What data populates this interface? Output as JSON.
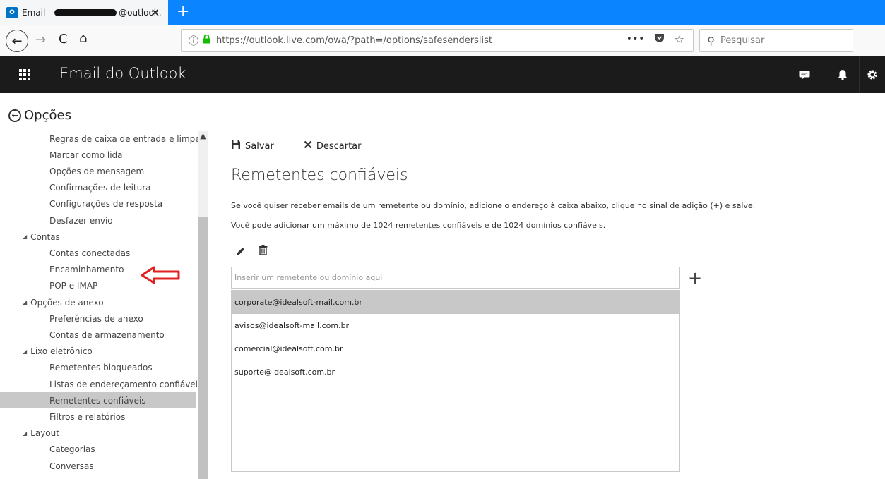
{
  "browser": {
    "tab": {
      "favicon": "O",
      "title_prefix": "Email –",
      "title_suffix": "@outlook.",
      "close": "✕"
    },
    "new_tab": "+",
    "nav": {
      "back": "←",
      "forward": "→",
      "reload": "C",
      "home": "⌂"
    },
    "url": "https://outlook.live.com/owa/?path=/options/safesenderslist",
    "url_actions": {
      "more": "•••",
      "pocket": "▼",
      "bookmark": "☆"
    },
    "search_placeholder": "Pesquisar"
  },
  "app": {
    "title": "Email do Outlook",
    "header_icons": [
      "chat-icon",
      "bell-icon",
      "gear-icon"
    ]
  },
  "options": {
    "title": "Opções"
  },
  "sidebar": {
    "items": [
      {
        "label": "Regras de caixa de entrada e limpeza",
        "kind": "child"
      },
      {
        "label": "Marcar como lida",
        "kind": "child"
      },
      {
        "label": "Opções de mensagem",
        "kind": "child"
      },
      {
        "label": "Confirmações de leitura",
        "kind": "child"
      },
      {
        "label": "Configurações de resposta",
        "kind": "child"
      },
      {
        "label": "Desfazer envio",
        "kind": "child"
      },
      {
        "label": "Contas",
        "kind": "group"
      },
      {
        "label": "Contas conectadas",
        "kind": "child"
      },
      {
        "label": "Encaminhamento",
        "kind": "child"
      },
      {
        "label": "POP e IMAP",
        "kind": "child"
      },
      {
        "label": "Opções de anexo",
        "kind": "group"
      },
      {
        "label": "Preferências de anexo",
        "kind": "child"
      },
      {
        "label": "Contas de armazenamento",
        "kind": "child"
      },
      {
        "label": "Lixo eletrônico",
        "kind": "group"
      },
      {
        "label": "Remetentes bloqueados",
        "kind": "child"
      },
      {
        "label": "Listas de endereçamento confiáveis",
        "kind": "child"
      },
      {
        "label": "Remetentes confiáveis",
        "kind": "child",
        "selected": true
      },
      {
        "label": "Filtros e relatórios",
        "kind": "child"
      },
      {
        "label": "Layout",
        "kind": "group"
      },
      {
        "label": "Categorias",
        "kind": "child"
      },
      {
        "label": "Conversas",
        "kind": "child"
      }
    ]
  },
  "toolbar": {
    "save_label": "Salvar",
    "discard_label": "Descartar"
  },
  "main": {
    "heading": "Remetentes confiáveis",
    "para1": "Se você quiser receber emails de um remetente ou domínio, adicione o endereço à caixa abaixo, clique no sinal de adição (+) e salve.",
    "para2": "Você pode adicionar um máximo de 1024 remetentes confiáveis e de 1024 domínios confiáveis.",
    "input_placeholder": "Inserir um remetente ou domínio aqui",
    "add_symbol": "+",
    "senders": [
      {
        "email": "corporate@idealsoft-mail.com.br",
        "selected": true
      },
      {
        "email": "avisos@idealsoft-mail.com.br",
        "selected": false
      },
      {
        "email": "comercial@idealsoft.com.br",
        "selected": false
      },
      {
        "email": "suporte@idealsoft.com.br",
        "selected": false
      }
    ]
  },
  "colors": {
    "tabstrip": "#0a84ff",
    "appbar": "#1b1b1b",
    "selected": "#c8c8c8",
    "annotation_arrow": "#e02020"
  }
}
